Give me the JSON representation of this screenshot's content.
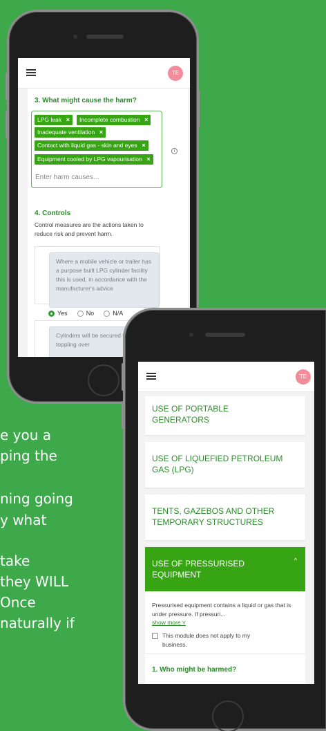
{
  "background_text": [
    "e you a",
    "ping the",
    "ning going",
    "y what",
    "take",
    "they WILL",
    "Once",
    "naturally if"
  ],
  "phone1": {
    "avatar": "TE",
    "question3": "3. What might cause the harm?",
    "tags": [
      "LPG leak",
      "Incomplete combustion",
      "Inadequate ventilation",
      "Contact with liquid gas - skin and eyes",
      "Equipment cooled by LPG vapourisation"
    ],
    "tag_remove": "×",
    "harm_placeholder": "Enter harm causes...",
    "info_icon": "i",
    "section4": "4. Controls",
    "controls_desc": "Control measures are the actions taken to reduce risk and prevent harm.",
    "control1": "Where a mobile vehicle or trailer has a purpose built LPG cylinder facility this is used, in accordance with the manufacturer's advice",
    "options": [
      "Yes",
      "No",
      "N/A"
    ],
    "control2": "Cylinders will be secured to prevent toppling over"
  },
  "phone2": {
    "avatar": "TE",
    "modules": [
      "USE OF PORTABLE GENERATORS",
      "USE OF LIQUEFIED PETROLEUM GAS (LPG)",
      "TENTS, GAZEBOS AND OTHER TEMPORARY STRUCTURES"
    ],
    "active_module": "USE OF PRESSURISED EQUIPMENT",
    "active_chevron": "^",
    "module_desc": "Pressurised equipment contains a liquid or gas that is under pressure. If pressuri...",
    "show_more": "show more ˅",
    "not_apply": "This module does not apply to my business.",
    "question1": "1. Who might be harmed?"
  },
  "colors": {
    "background": "#3da94b",
    "accent": "#37a414",
    "avatar": "#f28b9a"
  }
}
